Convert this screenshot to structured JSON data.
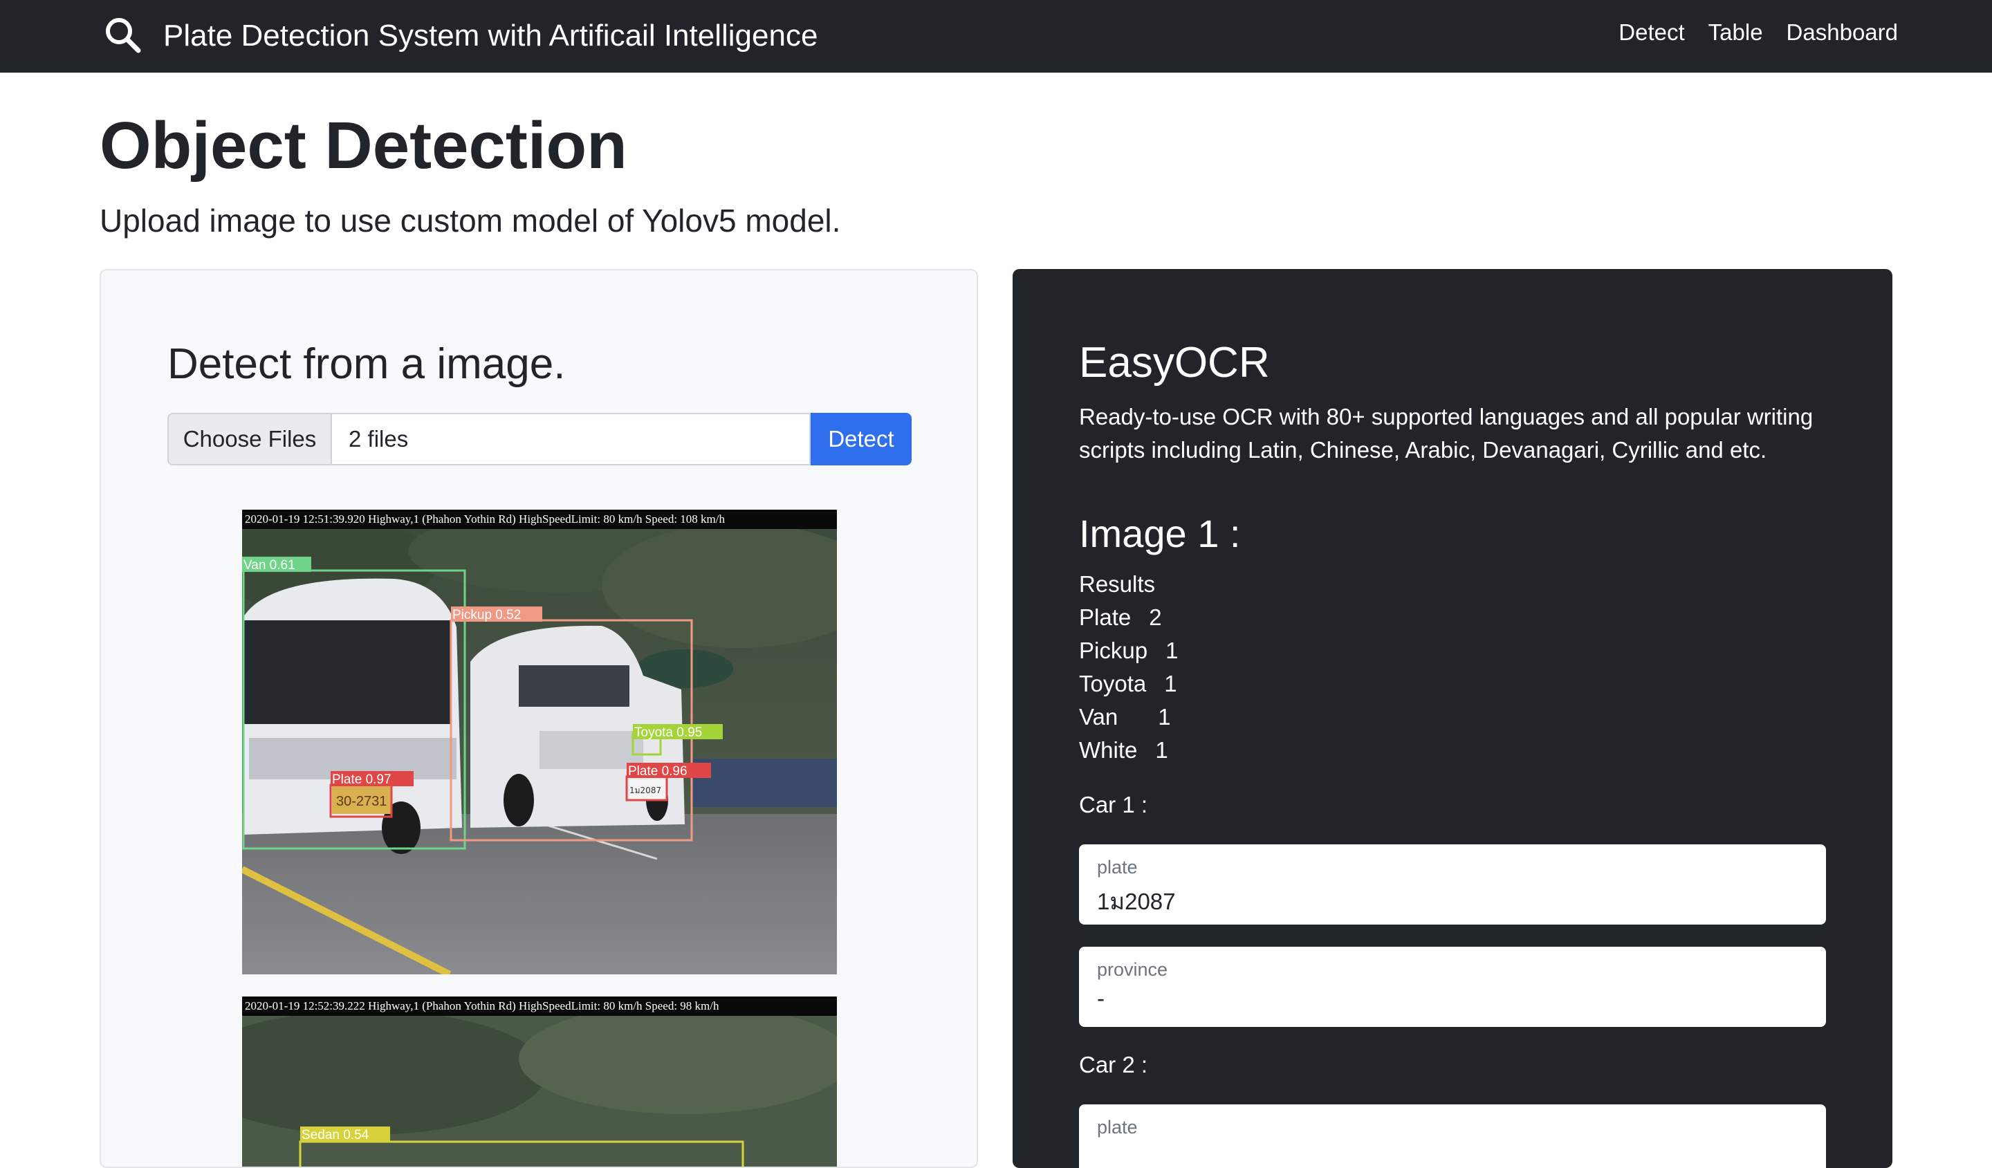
{
  "navbar": {
    "brand_title": "Plate Detection System with Artificail Intelligence",
    "links": [
      "Detect",
      "Table",
      "Dashboard"
    ]
  },
  "page": {
    "title": "Object Detection",
    "subtitle": "Upload image to use custom model of Yolov5 model."
  },
  "detect_panel": {
    "title": "Detect from a image.",
    "choose_files_label": "Choose Files",
    "file_status": "2 files",
    "detect_button": "Detect",
    "images": [
      {
        "caption": "2020-01-19 12:51:39.920 Highway,1 (Phahon Yothin Rd) HighSpeedLimit: 80 km/h Speed: 108 km/h",
        "detections": [
          {
            "label": "Van  0.61"
          },
          {
            "label": "Pickup  0.52"
          },
          {
            "label": "Toyota  0.95"
          },
          {
            "label": "Plate  0.97"
          },
          {
            "label": "Plate  0.96"
          }
        ],
        "plate_texts": [
          "30-2731",
          "1ม2087"
        ]
      },
      {
        "caption": "2020-01-19 12:52:39.222 Highway,1 (Phahon Yothin Rd) HighSpeedLimit: 80 km/h Speed: 98 km/h",
        "detections": [
          {
            "label": "Sedan  0.54"
          }
        ]
      }
    ]
  },
  "ocr_panel": {
    "title": "EasyOCR",
    "description": "Ready-to-use OCR with 80+ supported languages and all popular writing scripts including Latin, Chinese, Arabic, Devanagari, Cyrillic and etc.",
    "image_title": "Image 1 :",
    "results_label": "Results",
    "results": [
      {
        "name": "Plate",
        "count": "2"
      },
      {
        "name": "Pickup",
        "count": "1"
      },
      {
        "name": "Toyota",
        "count": "1"
      },
      {
        "name": "Van",
        "count": "1"
      },
      {
        "name": "White",
        "count": "1"
      }
    ],
    "cars": [
      {
        "label": "Car 1 :",
        "fields": [
          {
            "label": "plate",
            "value": "1ม2087"
          },
          {
            "label": "province",
            "value": "-"
          }
        ]
      },
      {
        "label": "Car 2 :",
        "fields": [
          {
            "label": "plate",
            "value": ""
          }
        ]
      }
    ]
  },
  "colors": {
    "navbar_bg": "#212529",
    "primary_button": "#2f6fed",
    "van_box": "#6fd38a",
    "pickup_box": "#f09a86",
    "toyota_box": "#a4d33a",
    "plate_box": "#e04646",
    "sedan_box": "#d7d23a"
  }
}
